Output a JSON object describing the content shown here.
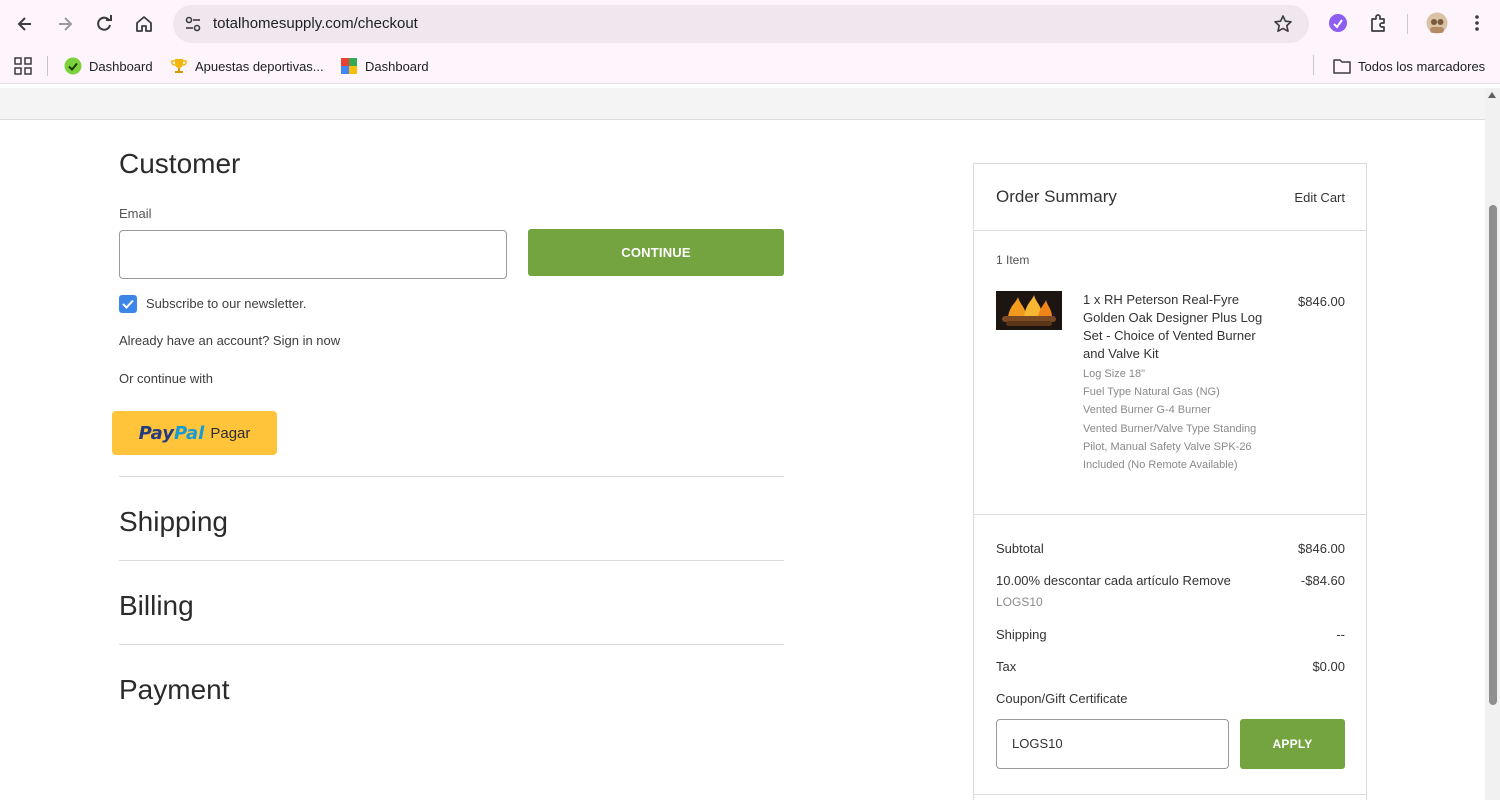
{
  "browser": {
    "url": "totalhomesupply.com/checkout",
    "bookmarks": [
      {
        "label": "Dashboard",
        "icon": "green-check-icon"
      },
      {
        "label": "Apuestas deportivas...",
        "icon": "trophy-icon"
      },
      {
        "label": "Dashboard",
        "icon": "colorful-app-icon"
      }
    ],
    "all_bookmarks_label": "Todos los marcadores"
  },
  "customer": {
    "title": "Customer",
    "email_label": "Email",
    "email_value": "",
    "continue_label": "CONTINUE",
    "newsletter_label": "Subscribe to our newsletter.",
    "newsletter_checked": true,
    "sign_in_text": "Already have an account? Sign in now",
    "or_continue": "Or continue with",
    "paypal_pay": "Pay",
    "paypal_pal": "Pal",
    "paypal_pagar": "Pagar"
  },
  "sections": {
    "shipping": "Shipping",
    "billing": "Billing",
    "payment": "Payment"
  },
  "summary": {
    "title": "Order Summary",
    "edit_cart": "Edit Cart",
    "items_count": "1 Item",
    "product": {
      "name": "1 x RH Peterson Real-Fyre Golden Oak Designer Plus Log Set - Choice of Vented Burner and Valve Kit",
      "price": "$846.00",
      "options": [
        "Log Size 18\"",
        "Fuel Type Natural Gas (NG)",
        "Vented Burner G-4 Burner",
        "Vented Burner/Valve Type Standing Pilot, Manual Safety Valve SPK-26 Included (No Remote Available)"
      ]
    },
    "subtotal_label": "Subtotal",
    "subtotal_value": "$846.00",
    "discount_label": "10.00% descontar cada artículo Remove",
    "discount_value": "-$84.60",
    "discount_code": "LOGS10",
    "shipping_label": "Shipping",
    "shipping_value": "--",
    "tax_label": "Tax",
    "tax_value": "$0.00",
    "coupon_label": "Coupon/Gift Certificate",
    "coupon_value": "LOGS10",
    "apply_label": "APPLY"
  },
  "colors": {
    "accent_green": "#74a440",
    "checkbox_blue": "#3b86e8",
    "paypal_yellow": "#ffc439"
  }
}
